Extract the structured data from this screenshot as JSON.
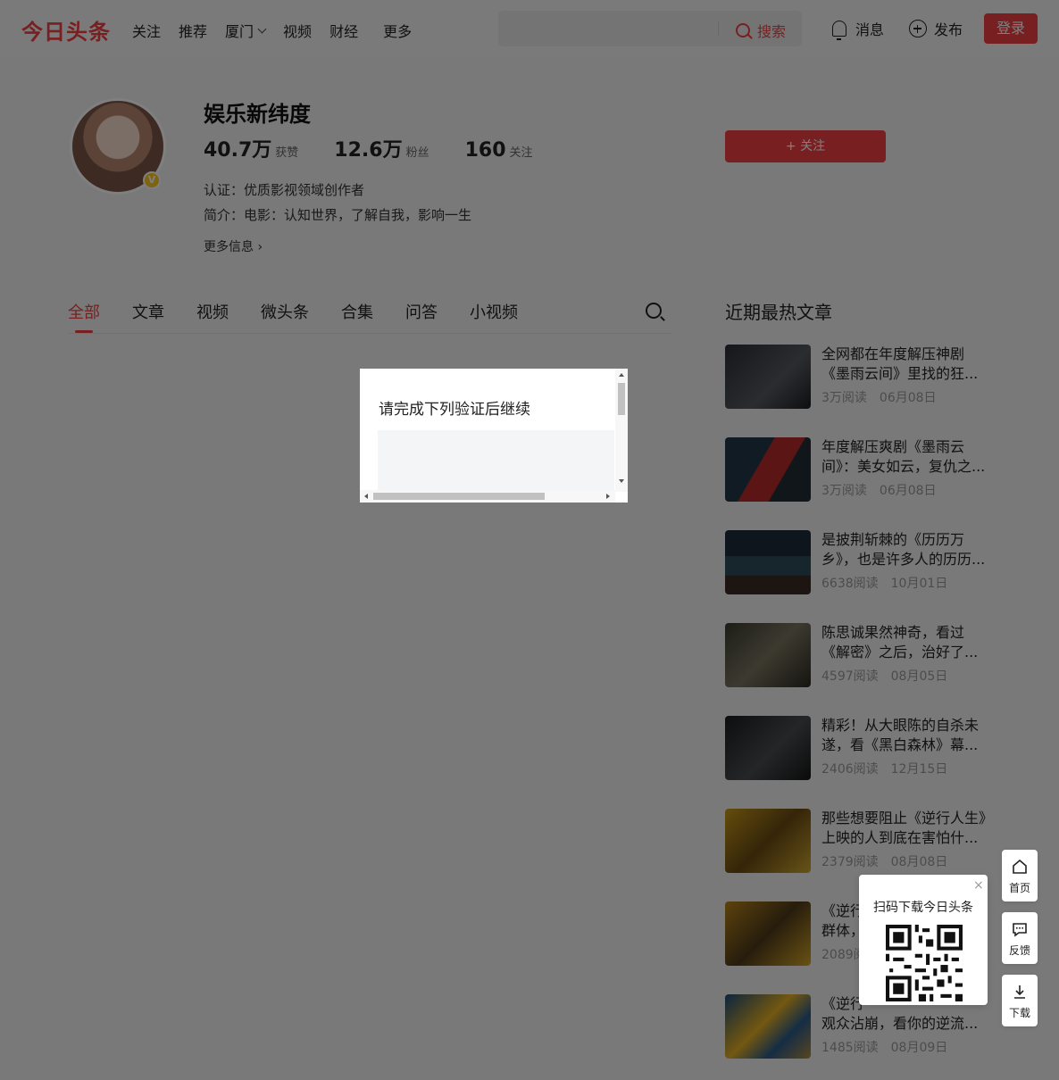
{
  "header": {
    "logo": "今日头条",
    "nav": [
      "关注",
      "推荐",
      "厦门",
      "视频",
      "财经",
      "更多"
    ],
    "search_button": "搜索",
    "messages": "消息",
    "publish": "发布",
    "login": "登录"
  },
  "profile": {
    "name": "娱乐新纬度",
    "badge": "V",
    "stats": [
      {
        "num": "40.7万",
        "label": "获赞"
      },
      {
        "num": "12.6万",
        "label": "粉丝"
      },
      {
        "num": "160",
        "label": "关注"
      }
    ],
    "certification": "认证：优质影视领域创作者",
    "bio": "简介：电影：认知世界，了解自我，影响一生",
    "more_info": "更多信息 ›",
    "follow_button": "+ 关注"
  },
  "tabs": [
    "全部",
    "文章",
    "视频",
    "微头条",
    "合集",
    "问答",
    "小视频"
  ],
  "active_tab": "全部",
  "hot": {
    "title": "近期最热文章",
    "items": [
      {
        "title": "全网都在年度解压神剧《墨雨云间》里找的狂...",
        "reads": "3万阅读",
        "date": "06月08日"
      },
      {
        "title": "年度解压爽剧《墨雨云间》：美女如云，复仇之...",
        "reads": "3万阅读",
        "date": "06月08日"
      },
      {
        "title": "是披荆斩棘的《历历万乡》，也是许多人的历历...",
        "reads": "6638阅读",
        "date": "10月01日"
      },
      {
        "title": "陈思诚果然神奇，看过《解密》之后，治好了...",
        "reads": "4597阅读",
        "date": "08月05日"
      },
      {
        "title": "精彩！从大眼陈的自杀未遂，看《黑白森林》幕...",
        "reads": "2406阅读",
        "date": "12月15日"
      },
      {
        "title": "那些想要阻止《逆行人生》上映的人到底在害怕什...",
        "reads": "2379阅读",
        "date": "08月08日"
      },
      {
        "title": "《逆行",
        "title2": "群体，",
        "reads": "2089阅",
        "date": ""
      },
      {
        "title": "《逆行",
        "title2": "观众沾崩，看你的逆流...",
        "reads": "1485阅读",
        "date": "08月09日"
      }
    ]
  },
  "modal": {
    "title": "请完成下列验证后继续"
  },
  "qr": {
    "text": "扫码下载今日头条",
    "close": "×"
  },
  "side": [
    {
      "label": "首页",
      "icon": "home-icon"
    },
    {
      "label": "反馈",
      "icon": "feedback-icon"
    },
    {
      "label": "下载",
      "icon": "download-icon"
    }
  ],
  "colors": {
    "accent": "#f04142",
    "mask": "rgba(0,0,0,0.5)"
  }
}
